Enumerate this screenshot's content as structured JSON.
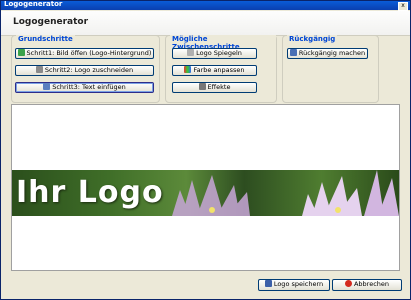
{
  "window": {
    "title": "Logogenerator",
    "close_glyph": "x"
  },
  "header": {
    "title": "Logogenerator"
  },
  "groups": {
    "basic": {
      "title": "Grundschritte",
      "buttons": [
        {
          "label": "Schritt1: Bild öffen (Logo-Hintergrund)",
          "icon": "open-image-icon"
        },
        {
          "label": "Schritt2: Logo zuschneiden",
          "icon": "crop-icon"
        },
        {
          "label": "Schritt3: Text einfügen",
          "icon": "text-icon"
        }
      ]
    },
    "optional": {
      "title": "Mögliche Zwischenschritte",
      "buttons": [
        {
          "label": "Logo Spiegeln",
          "icon": "mirror-icon"
        },
        {
          "label": "Farbe anpassen",
          "icon": "color-icon"
        },
        {
          "label": "Effekte",
          "icon": "effects-icon"
        }
      ]
    },
    "undo": {
      "title": "Rückgängig",
      "buttons": [
        {
          "label": "Rückgängig machen",
          "icon": "undo-icon"
        }
      ]
    }
  },
  "preview": {
    "logo_text": "Ihr Logo"
  },
  "footer": {
    "save_label": "Logo speichern",
    "cancel_label": "Abbrechen"
  },
  "colors": {
    "accent": "#0046d5",
    "titlebar": "#0a3fb0"
  }
}
